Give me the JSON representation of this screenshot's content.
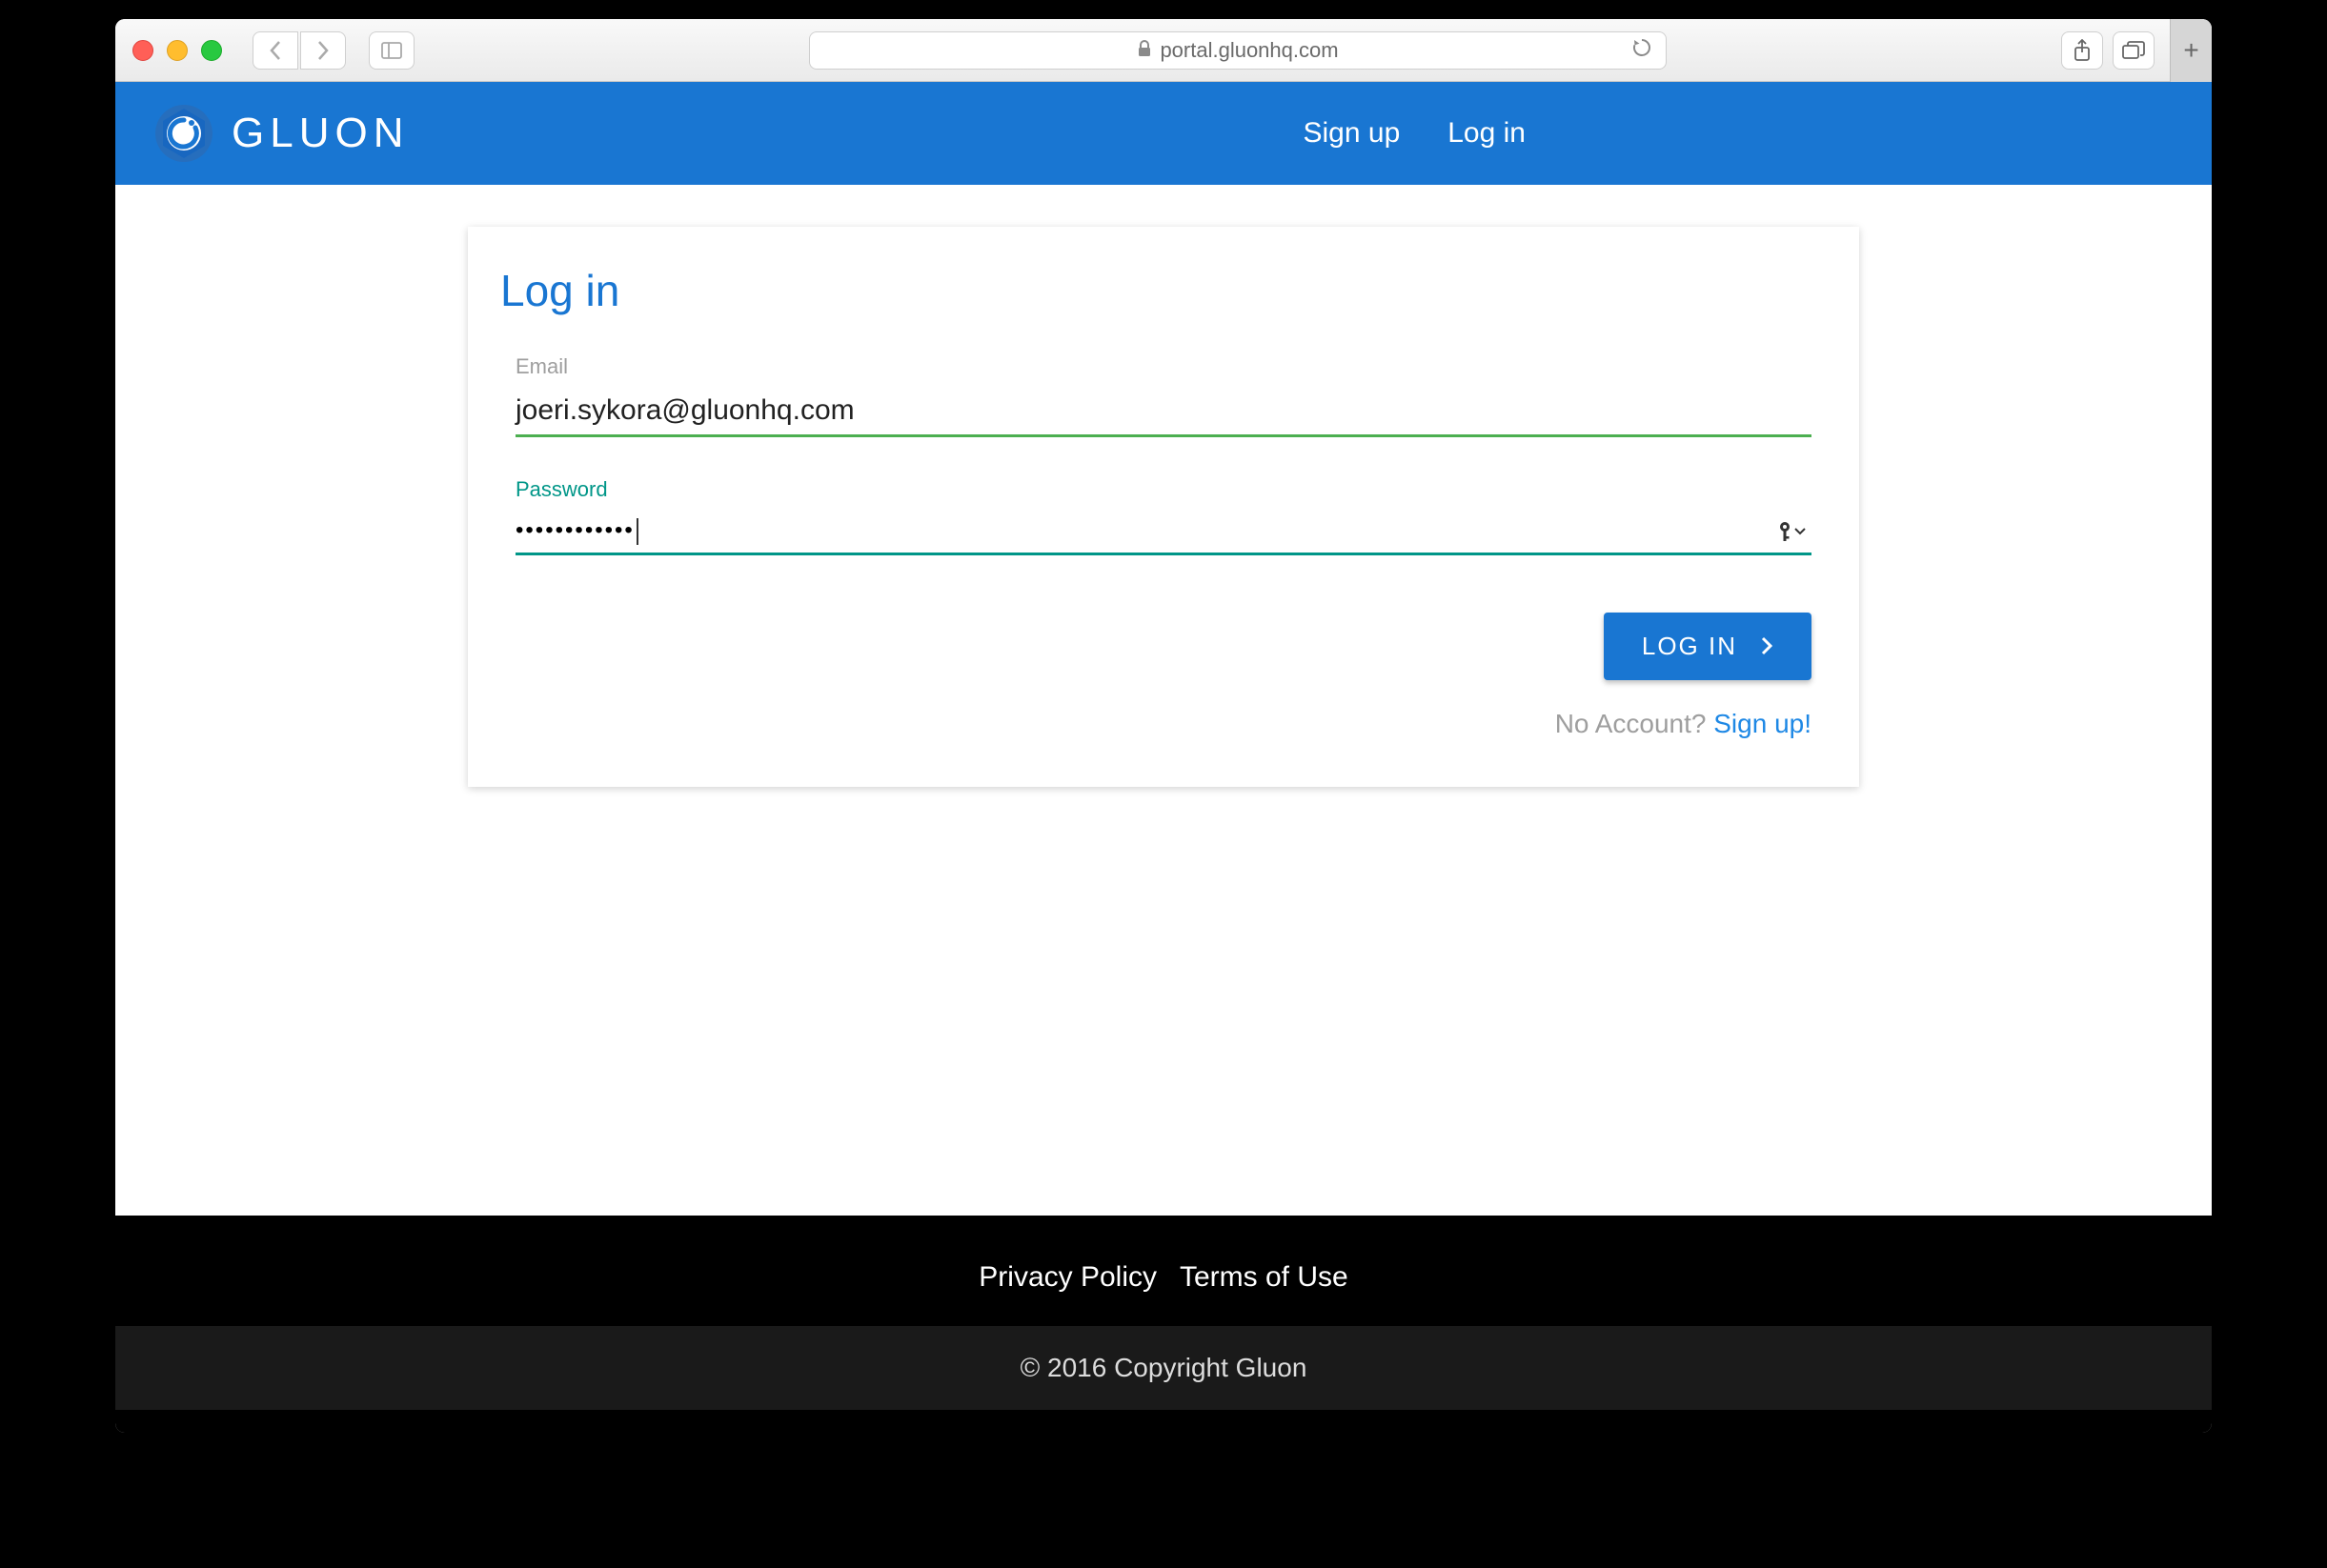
{
  "browser": {
    "url_display": "portal.gluonhq.com"
  },
  "header": {
    "brand": "GLUON",
    "nav": {
      "signup": "Sign up",
      "login": "Log in"
    }
  },
  "login": {
    "title": "Log in",
    "email_label": "Email",
    "email_value": "joeri.sykora@gluonhq.com",
    "password_label": "Password",
    "password_value": "••••••••••••",
    "submit_label": "LOG IN",
    "no_account_text": "No Account? ",
    "signup_link": "Sign up!"
  },
  "footer": {
    "privacy": "Privacy Policy",
    "terms": "Terms of Use",
    "copyright": "© 2016 Copyright Gluon"
  }
}
